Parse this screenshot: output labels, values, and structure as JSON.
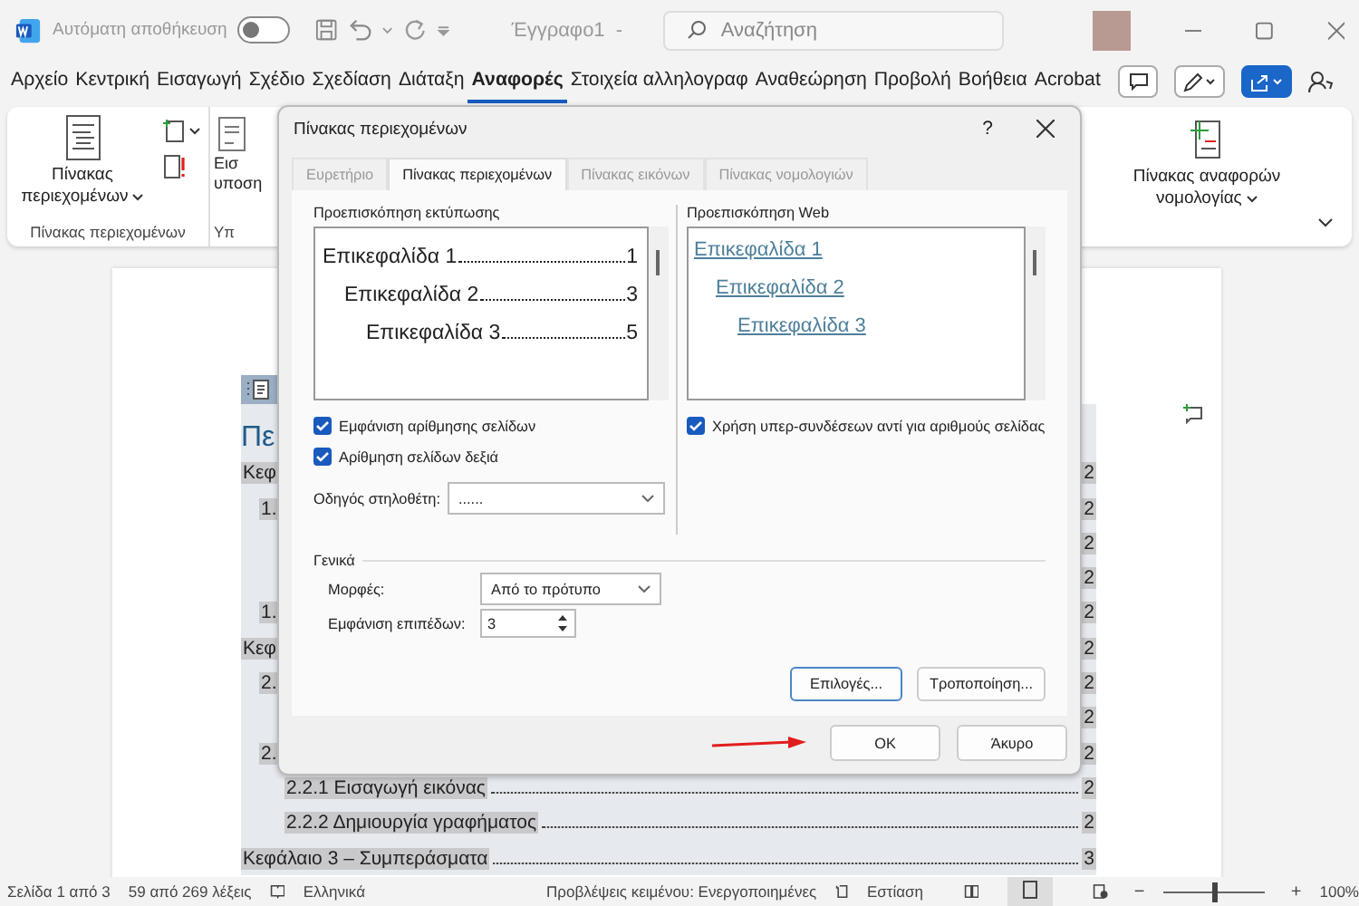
{
  "titlebar": {
    "autosave_label": "Αυτόματη αποθήκευση",
    "autosave_on": false,
    "doc_title": "Έγγραφο1  -",
    "search_placeholder": "Αναζήτηση"
  },
  "menu": [
    {
      "label": "Αρχείο",
      "selected": false
    },
    {
      "label": "Κεντρική",
      "selected": false
    },
    {
      "label": "Εισαγωγή",
      "selected": false
    },
    {
      "label": "Σχέδιο",
      "selected": false
    },
    {
      "label": "Σχεδίαση",
      "selected": false
    },
    {
      "label": "Διάταξη",
      "selected": false
    },
    {
      "label": "Αναφορές",
      "selected": true
    },
    {
      "label": "Στοιχεία αλληλογραφ",
      "selected": false
    },
    {
      "label": "Αναθεώρηση",
      "selected": false
    },
    {
      "label": "Προβολή",
      "selected": false
    },
    {
      "label": "Βοήθεια",
      "selected": false
    },
    {
      "label": "Acrobat",
      "selected": false
    }
  ],
  "ribbon": {
    "toc_button": "Πίνακας περιεχομένων",
    "toc_group": "Πίνακας περιεχομένων",
    "partial_button_lines": [
      "Εισ",
      "υποση"
    ],
    "partial_group": "Υπ",
    "authorities_button": "Πίνακας αναφορών νομολογίας"
  },
  "document": {
    "heading": "Πε",
    "rows": [
      {
        "text": "Κεφ",
        "page": "2",
        "children": [
          {
            "text": "1.",
            "page": "2",
            "children": [
              {
                "page": "2"
              },
              {
                "page": "2"
              }
            ]
          },
          {
            "text": "1.",
            "page": "2"
          }
        ]
      },
      {
        "text": "Κεφ",
        "page": "2",
        "children": [
          {
            "text": "2.",
            "page": "2",
            "children": [
              {
                "page": "2"
              }
            ]
          },
          {
            "text": "2.",
            "page": "2",
            "children": [
              {
                "text": "2.2.1 Εισαγωγή εικόνας",
                "page": "2"
              },
              {
                "text": "2.2.2 Δημιουργία γραφήματος",
                "page": "2"
              }
            ]
          }
        ]
      },
      {
        "text": "Κεφάλαιο 3 – Συμπεράσματα",
        "page": "3"
      }
    ]
  },
  "dialog": {
    "title": "Πίνακας περιεχομένων",
    "help": "?",
    "tabs": [
      {
        "label": "Ευρετήριο",
        "selected": false
      },
      {
        "label": "Πίνακας περιεχομένων",
        "selected": true
      },
      {
        "label": "Πίνακας εικόνων",
        "selected": false
      },
      {
        "label": "Πίνακας νομολογιών",
        "selected": false
      }
    ],
    "print_preview": {
      "label": "Προεπισκόπηση εκτύπωσης",
      "entries": [
        {
          "text": "Επικεφαλίδα 1",
          "page": "1",
          "children": [
            {
              "text": "Επικεφαλίδα 2",
              "page": "3",
              "children": [
                {
                  "text": "Επικεφαλίδα 3",
                  "page": "5"
                }
              ]
            }
          ]
        }
      ]
    },
    "web_preview": {
      "label": "Προεπισκόπηση Web",
      "entries": [
        {
          "text": "Επικεφαλίδα 1",
          "children": [
            {
              "text": "Επικεφαλίδα 2",
              "children": [
                {
                  "text": "Επικεφαλίδα 3"
                }
              ]
            }
          ]
        }
      ]
    },
    "show_page_numbers": {
      "label": "Εμφάνιση αρίθμησης σελίδων",
      "checked": true
    },
    "right_align": {
      "label": "Αρίθμηση σελίδων δεξιά",
      "checked": true
    },
    "use_hyperlinks": {
      "label": "Χρήση υπερ-συνδέσεων αντί για αριθμούς σελίδας",
      "checked": true
    },
    "tab_leader": {
      "label": "Οδηγός στηλοθέτη:",
      "value": "......"
    },
    "general_label": "Γενικά",
    "formats": {
      "label": "Μορφές:",
      "value": "Από το πρότυπο"
    },
    "levels": {
      "label": "Εμφάνιση επιπέδων:",
      "value": "3"
    },
    "options_button": "Επιλογές...",
    "modify_button": "Τροποποίηση...",
    "ok_button": "OK",
    "cancel_button": "Άκυρο"
  },
  "status_bar": {
    "page": "Σελίδα 1 από 3",
    "words": "59 από 269 λέξεις",
    "language": "Ελληνικά",
    "predictions": "Προβλέψεις κειμένου: Ενεργοποιημένες",
    "focus": "Εστίαση",
    "zoom_minus": "−",
    "zoom_plus": "+",
    "zoom": {
      "level": 0.5
    },
    "zoom_label": "100%"
  }
}
